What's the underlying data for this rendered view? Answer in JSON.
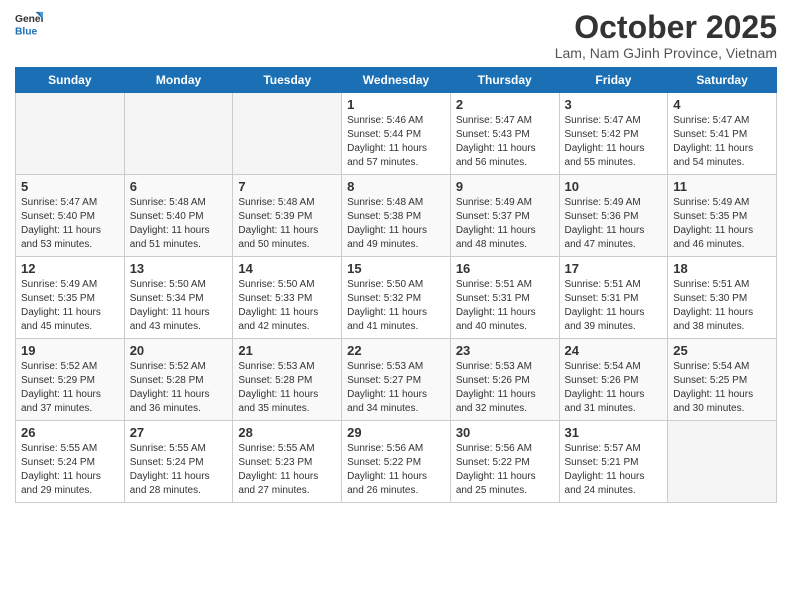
{
  "header": {
    "logo_general": "General",
    "logo_blue": "Blue",
    "month_title": "October 2025",
    "subtitle": "Lam, Nam GJinh Province, Vietnam"
  },
  "weekdays": [
    "Sunday",
    "Monday",
    "Tuesday",
    "Wednesday",
    "Thursday",
    "Friday",
    "Saturday"
  ],
  "weeks": [
    [
      {
        "day": "",
        "info": ""
      },
      {
        "day": "",
        "info": ""
      },
      {
        "day": "",
        "info": ""
      },
      {
        "day": "1",
        "info": "Sunrise: 5:46 AM\nSunset: 5:44 PM\nDaylight: 11 hours\nand 57 minutes."
      },
      {
        "day": "2",
        "info": "Sunrise: 5:47 AM\nSunset: 5:43 PM\nDaylight: 11 hours\nand 56 minutes."
      },
      {
        "day": "3",
        "info": "Sunrise: 5:47 AM\nSunset: 5:42 PM\nDaylight: 11 hours\nand 55 minutes."
      },
      {
        "day": "4",
        "info": "Sunrise: 5:47 AM\nSunset: 5:41 PM\nDaylight: 11 hours\nand 54 minutes."
      }
    ],
    [
      {
        "day": "5",
        "info": "Sunrise: 5:47 AM\nSunset: 5:40 PM\nDaylight: 11 hours\nand 53 minutes."
      },
      {
        "day": "6",
        "info": "Sunrise: 5:48 AM\nSunset: 5:40 PM\nDaylight: 11 hours\nand 51 minutes."
      },
      {
        "day": "7",
        "info": "Sunrise: 5:48 AM\nSunset: 5:39 PM\nDaylight: 11 hours\nand 50 minutes."
      },
      {
        "day": "8",
        "info": "Sunrise: 5:48 AM\nSunset: 5:38 PM\nDaylight: 11 hours\nand 49 minutes."
      },
      {
        "day": "9",
        "info": "Sunrise: 5:49 AM\nSunset: 5:37 PM\nDaylight: 11 hours\nand 48 minutes."
      },
      {
        "day": "10",
        "info": "Sunrise: 5:49 AM\nSunset: 5:36 PM\nDaylight: 11 hours\nand 47 minutes."
      },
      {
        "day": "11",
        "info": "Sunrise: 5:49 AM\nSunset: 5:35 PM\nDaylight: 11 hours\nand 46 minutes."
      }
    ],
    [
      {
        "day": "12",
        "info": "Sunrise: 5:49 AM\nSunset: 5:35 PM\nDaylight: 11 hours\nand 45 minutes."
      },
      {
        "day": "13",
        "info": "Sunrise: 5:50 AM\nSunset: 5:34 PM\nDaylight: 11 hours\nand 43 minutes."
      },
      {
        "day": "14",
        "info": "Sunrise: 5:50 AM\nSunset: 5:33 PM\nDaylight: 11 hours\nand 42 minutes."
      },
      {
        "day": "15",
        "info": "Sunrise: 5:50 AM\nSunset: 5:32 PM\nDaylight: 11 hours\nand 41 minutes."
      },
      {
        "day": "16",
        "info": "Sunrise: 5:51 AM\nSunset: 5:31 PM\nDaylight: 11 hours\nand 40 minutes."
      },
      {
        "day": "17",
        "info": "Sunrise: 5:51 AM\nSunset: 5:31 PM\nDaylight: 11 hours\nand 39 minutes."
      },
      {
        "day": "18",
        "info": "Sunrise: 5:51 AM\nSunset: 5:30 PM\nDaylight: 11 hours\nand 38 minutes."
      }
    ],
    [
      {
        "day": "19",
        "info": "Sunrise: 5:52 AM\nSunset: 5:29 PM\nDaylight: 11 hours\nand 37 minutes."
      },
      {
        "day": "20",
        "info": "Sunrise: 5:52 AM\nSunset: 5:28 PM\nDaylight: 11 hours\nand 36 minutes."
      },
      {
        "day": "21",
        "info": "Sunrise: 5:53 AM\nSunset: 5:28 PM\nDaylight: 11 hours\nand 35 minutes."
      },
      {
        "day": "22",
        "info": "Sunrise: 5:53 AM\nSunset: 5:27 PM\nDaylight: 11 hours\nand 34 minutes."
      },
      {
        "day": "23",
        "info": "Sunrise: 5:53 AM\nSunset: 5:26 PM\nDaylight: 11 hours\nand 32 minutes."
      },
      {
        "day": "24",
        "info": "Sunrise: 5:54 AM\nSunset: 5:26 PM\nDaylight: 11 hours\nand 31 minutes."
      },
      {
        "day": "25",
        "info": "Sunrise: 5:54 AM\nSunset: 5:25 PM\nDaylight: 11 hours\nand 30 minutes."
      }
    ],
    [
      {
        "day": "26",
        "info": "Sunrise: 5:55 AM\nSunset: 5:24 PM\nDaylight: 11 hours\nand 29 minutes."
      },
      {
        "day": "27",
        "info": "Sunrise: 5:55 AM\nSunset: 5:24 PM\nDaylight: 11 hours\nand 28 minutes."
      },
      {
        "day": "28",
        "info": "Sunrise: 5:55 AM\nSunset: 5:23 PM\nDaylight: 11 hours\nand 27 minutes."
      },
      {
        "day": "29",
        "info": "Sunrise: 5:56 AM\nSunset: 5:22 PM\nDaylight: 11 hours\nand 26 minutes."
      },
      {
        "day": "30",
        "info": "Sunrise: 5:56 AM\nSunset: 5:22 PM\nDaylight: 11 hours\nand 25 minutes."
      },
      {
        "day": "31",
        "info": "Sunrise: 5:57 AM\nSunset: 5:21 PM\nDaylight: 11 hours\nand 24 minutes."
      },
      {
        "day": "",
        "info": ""
      }
    ]
  ]
}
